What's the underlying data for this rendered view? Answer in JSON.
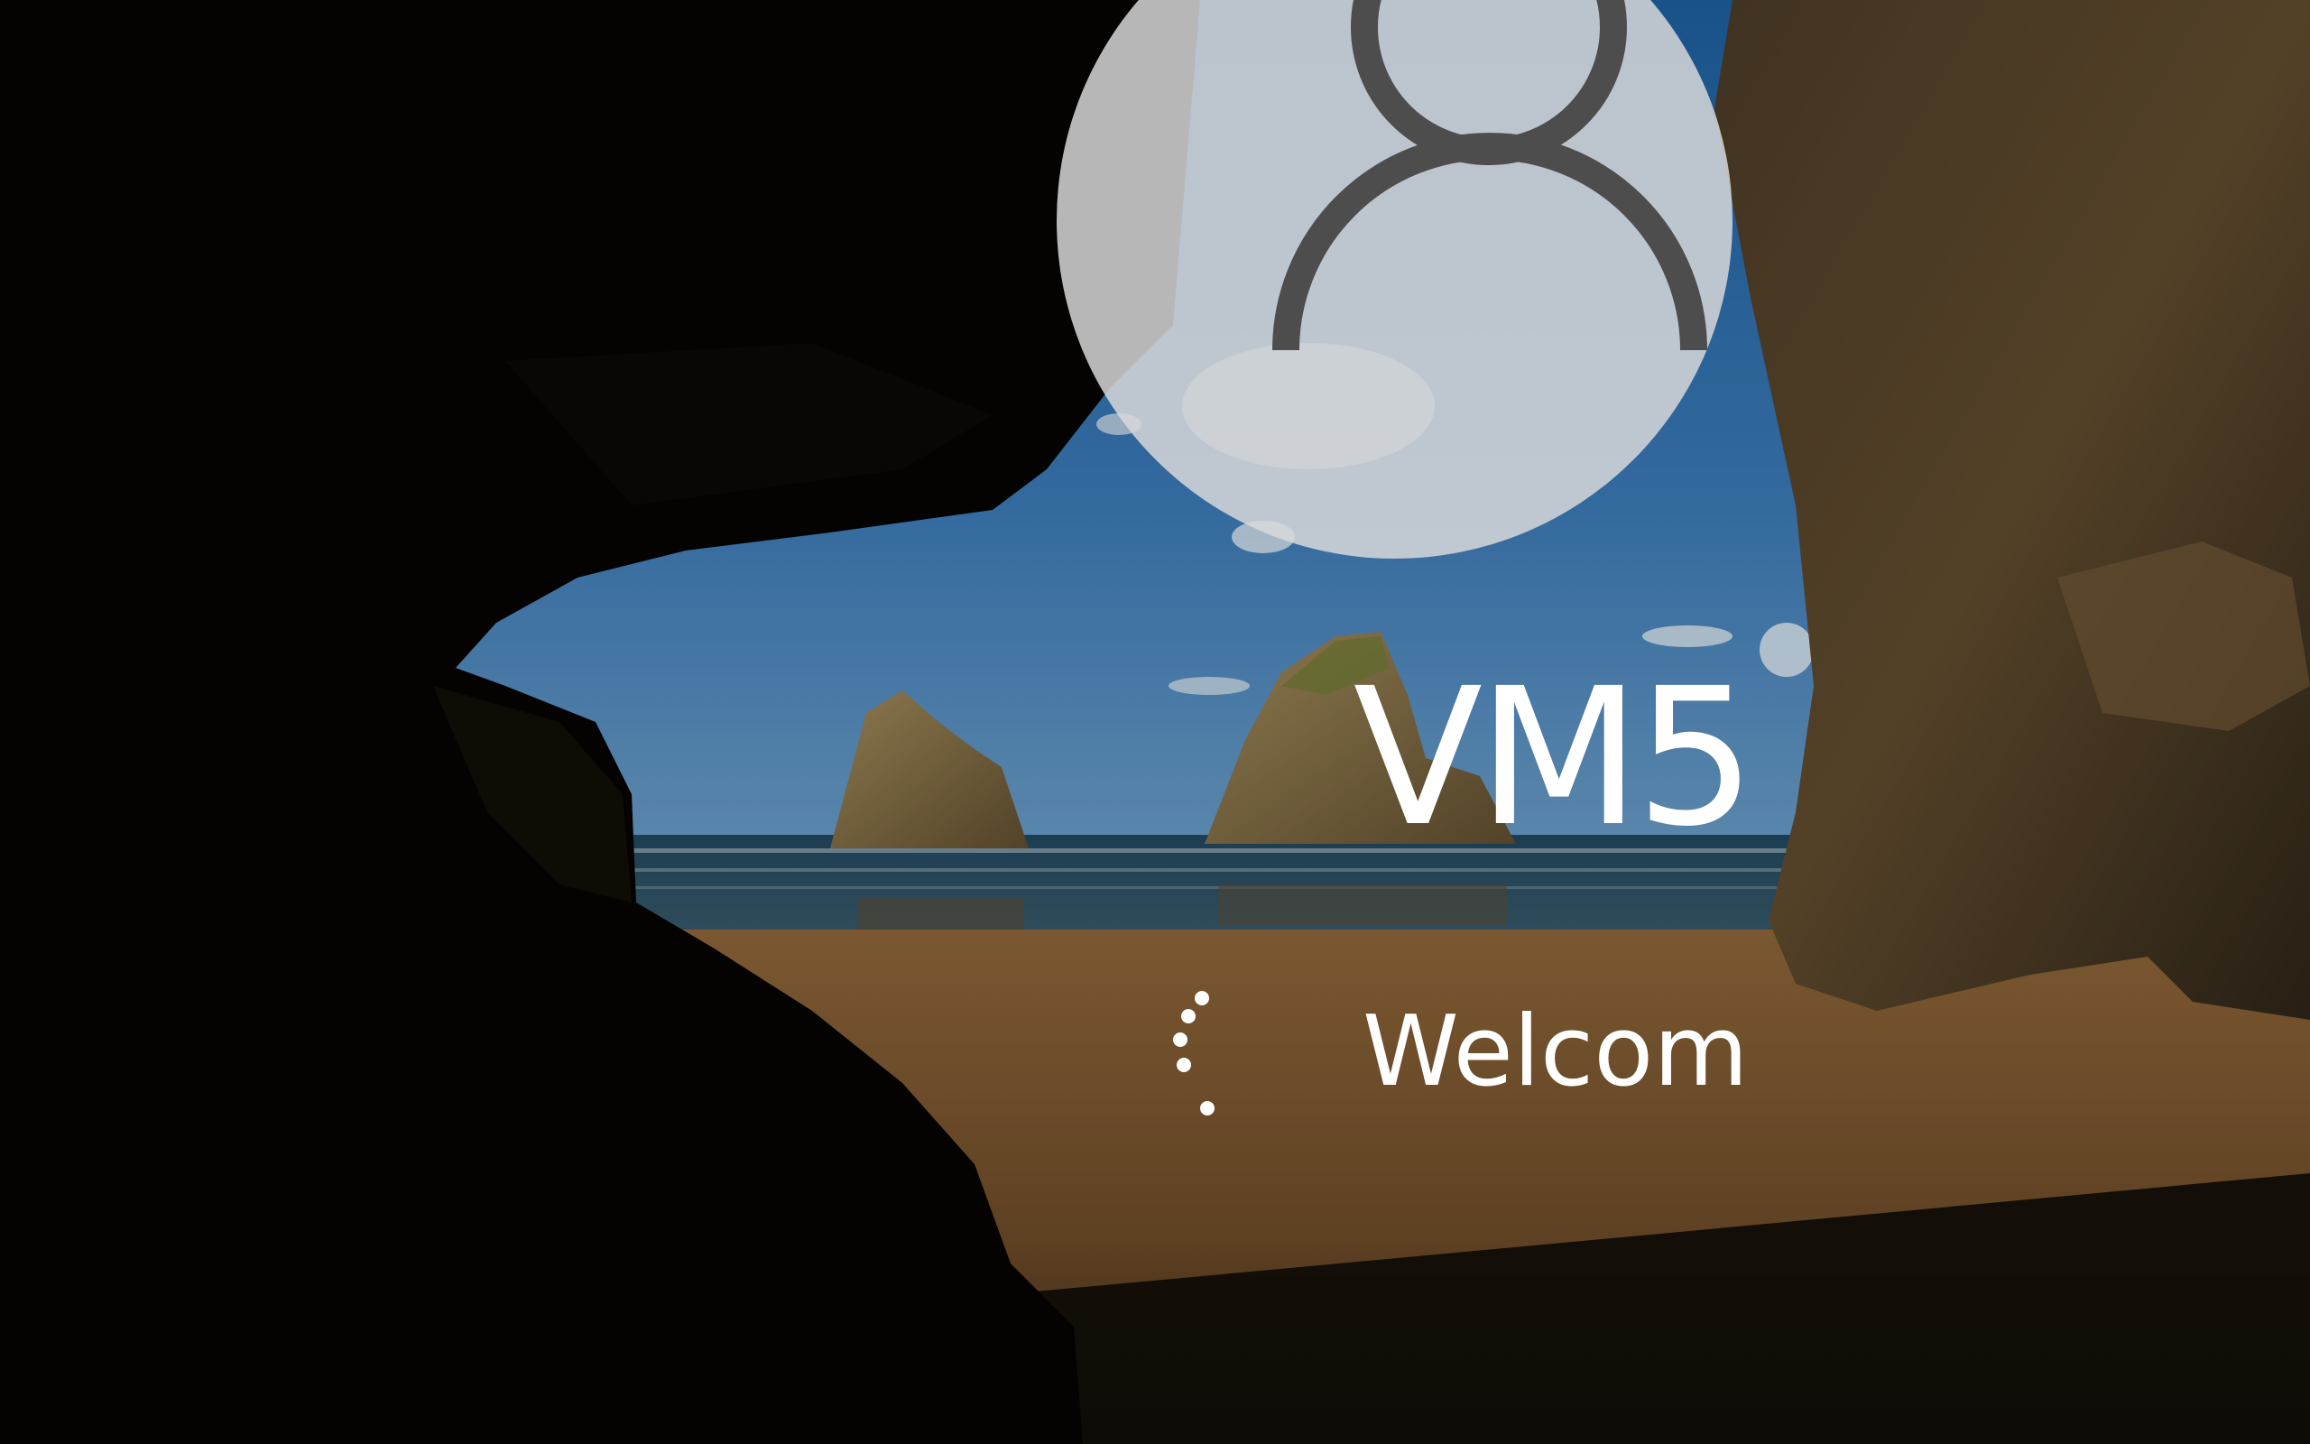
{
  "login": {
    "username": "VM5",
    "status_text": "Welcom"
  },
  "icons": {
    "avatar": "user-silhouette-icon",
    "spinner": "loading-spinner-icon"
  },
  "colors": {
    "avatar_background": "#dadada",
    "avatar_glyph": "#4d4d4d",
    "text": "#ffffff",
    "sky": "#2f6aa8",
    "sand": "#7a5530"
  }
}
